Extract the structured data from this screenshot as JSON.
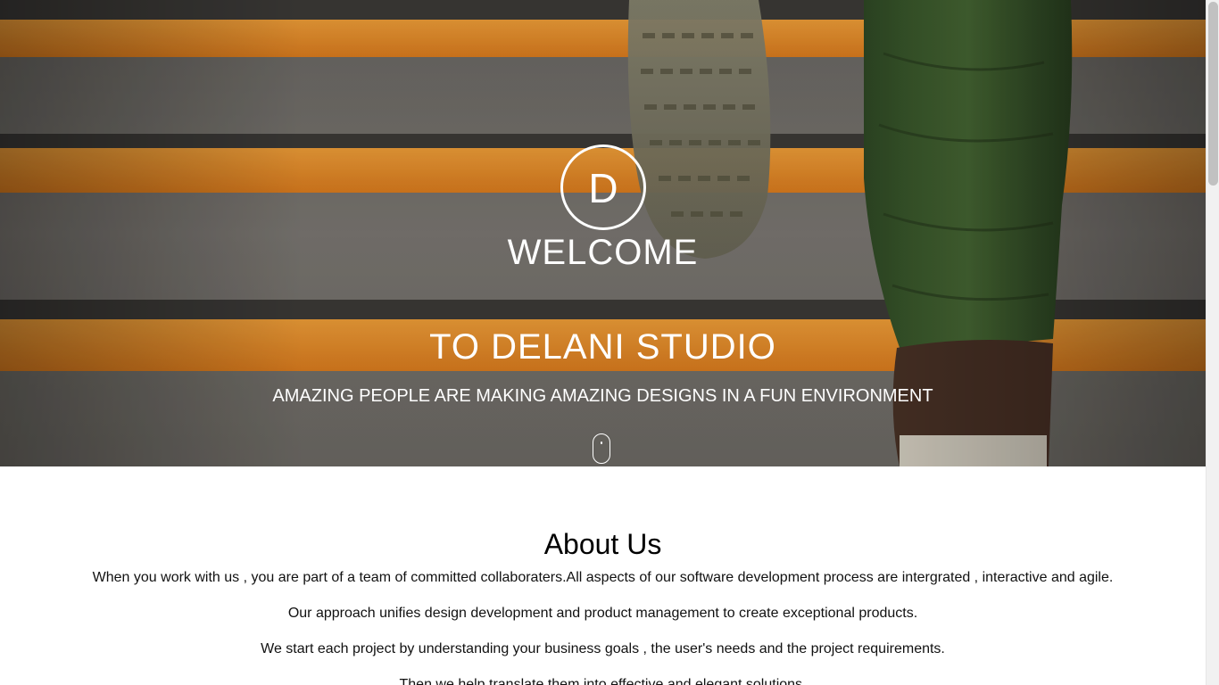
{
  "hero": {
    "logo_letter": "D",
    "welcome": "WELCOME",
    "studio": "TO DELANI STUDIO",
    "tagline": "AMAZING PEOPLE ARE MAKING AMAZING DESIGNS IN A FUN ENVIRONMENT",
    "scroll_icon": "mouse-scroll-icon",
    "background_image": "stairs-with-orange-stripes-and-walking-foot"
  },
  "about": {
    "title": "About Us",
    "paragraphs": [
      "When you work with us , you are part of a team of committed collaboraters.All aspects of our software development process are intergrated , interactive and agile.",
      "Our approach unifies design development and product management to create exceptional products.",
      "We start each project by understanding your business goals , the user's needs and the project requirements.",
      "Then we help translate them into effective and elegant solutions."
    ]
  },
  "colors": {
    "hero_text": "#ffffff",
    "stripe_orange": "#f2962e",
    "stair_gray": "#6e6b66",
    "body_text": "#111111",
    "background": "#ffffff"
  }
}
